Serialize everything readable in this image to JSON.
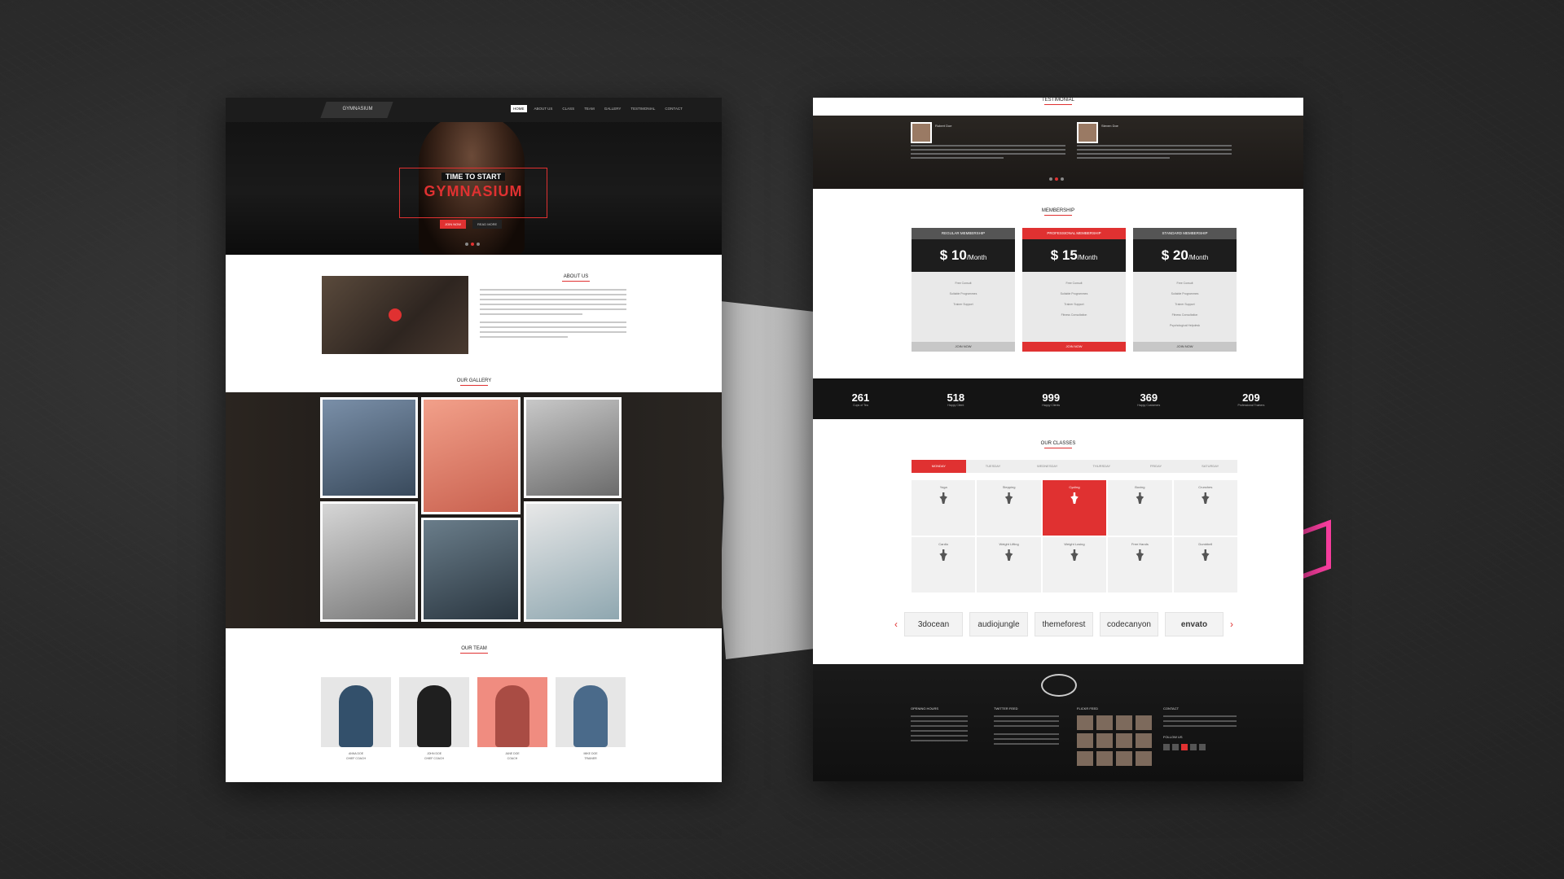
{
  "left_page": {
    "logo_text": "GYMNASIUM",
    "nav_items": [
      "HOME",
      "ABOUT US",
      "CLASS",
      "TEAM",
      "GALLERY",
      "TESTIMONIAL",
      "CONTACT"
    ],
    "hero": {
      "kicker": "TIME TO START",
      "title": "GYMNASIUM",
      "btn_primary": "JOIN NOW",
      "btn_secondary": "READ MORE"
    },
    "about_title": "ABOUT US",
    "gallery_title": "OUR GALLERY",
    "team_title": "OUR TEAM",
    "team": [
      {
        "name": "ANNA DOE",
        "role": "CHIEF COACH"
      },
      {
        "name": "JOHN DOE",
        "role": "CHIEF COACH"
      },
      {
        "name": "JANE DOE",
        "role": "COACH"
      },
      {
        "name": "MIKE DOE",
        "role": "TRAINER"
      }
    ]
  },
  "right_page": {
    "testimonial_title": "TESTIMONIAL",
    "testimonials": [
      {
        "name": "Robert Doe"
      },
      {
        "name": "Steven Doe"
      }
    ],
    "membership_title": "MEMBERSHIP",
    "plans": [
      {
        "name": "REGULAR MEMBERSHIP",
        "price": "$ 10",
        "period": "/Month",
        "features": [
          "Free Consult",
          "Suitable Programmes",
          "Trainer Support",
          "",
          ""
        ],
        "button": "JOIN NOW"
      },
      {
        "name": "PROFESSIONAL MEMBERSHIP",
        "price": "$ 15",
        "period": "/Month",
        "features": [
          "Free Consult",
          "Suitable Programmes",
          "Trainer Support",
          "Fitness Consultation",
          ""
        ],
        "button": "JOIN NOW"
      },
      {
        "name": "STANDARD MEMBERSHIP",
        "price": "$ 20",
        "period": "/Month",
        "features": [
          "Free Consult",
          "Suitable Programmes",
          "Trainer Support",
          "Fitness Consultation",
          "Psychological Helpdesk"
        ],
        "button": "JOIN NOW"
      }
    ],
    "stats": [
      {
        "value": "261",
        "label": "Cups of Tea"
      },
      {
        "value": "518",
        "label": "Happy Client"
      },
      {
        "value": "999",
        "label": "Happy Clients"
      },
      {
        "value": "369",
        "label": "Happy Customers"
      },
      {
        "value": "209",
        "label": "Professional Trainers"
      }
    ],
    "classes_title": "OUR CLASSES",
    "tabs": [
      "MONDAY",
      "TUESDAY",
      "WEDNESDAY",
      "THURSDAY",
      "FRIDAY",
      "SATURDAY"
    ],
    "classes": [
      "Yoga",
      "Stepping",
      "Cycling",
      "Boxing",
      "Crunches",
      "Cardio",
      "Weight Lifting",
      "Weight Losing",
      "Free Hands",
      "Dumbbell"
    ],
    "clients": [
      "3docean",
      "audiojungle",
      "themeforest",
      "codecanyon",
      "envato"
    ],
    "footer": {
      "col1": "OPENING HOURS",
      "col2": "TWITTER FEED",
      "col3": "FLICKR FEED",
      "col4": "CONTACT",
      "social_title": "FOLLOW US"
    }
  }
}
